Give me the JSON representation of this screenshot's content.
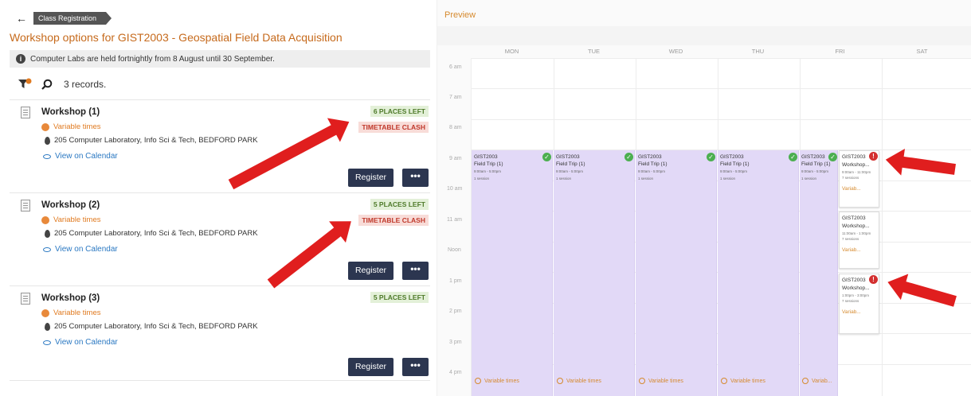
{
  "breadcrumb": {
    "back_icon": "arrow-left-icon",
    "label": "Class Registration"
  },
  "page_title": "Workshop options for GIST2003 - Geospatial Field Data Acquisition",
  "info_banner": "Computer Labs are held fortnightly from 8 August until 30 September.",
  "records_text": "3 records.",
  "workshops": [
    {
      "title": "Workshop (1)",
      "places": "6 PLACES LEFT",
      "clash": "TIMETABLE CLASH",
      "times": "Variable times",
      "location": "205 Computer Laboratory, Info Sci & Tech, BEDFORD PARK",
      "calendar_link": "View on Calendar",
      "register": "Register",
      "more": "•••"
    },
    {
      "title": "Workshop (2)",
      "places": "5 PLACES LEFT",
      "clash": "TIMETABLE CLASH",
      "times": "Variable times",
      "location": "205 Computer Laboratory, Info Sci & Tech, BEDFORD PARK",
      "calendar_link": "View on Calendar",
      "register": "Register",
      "more": "•••"
    },
    {
      "title": "Workshop (3)",
      "places": "5 PLACES LEFT",
      "clash": "",
      "times": "Variable times",
      "location": "205 Computer Laboratory, Info Sci & Tech, BEDFORD PARK",
      "calendar_link": "View on Calendar",
      "register": "Register",
      "more": "•••"
    }
  ],
  "preview": {
    "label": "Preview",
    "days": [
      "MON",
      "TUE",
      "WED",
      "THU",
      "FRI",
      "SAT"
    ],
    "times": [
      "6 am",
      "7 am",
      "8 am",
      "9 am",
      "10 am",
      "11 am",
      "Noon",
      "1 pm",
      "2 pm",
      "3 pm",
      "4 pm"
    ],
    "field_trips": [
      {
        "code": "GIST2003",
        "name": "Field Trip (1)",
        "time": "9:00am - 5:00pm",
        "sessions": "1 session",
        "footer": "Variable times"
      },
      {
        "code": "GIST2003",
        "name": "Field Trip (1)",
        "time": "9:00am - 5:00pm",
        "sessions": "1 session",
        "footer": "Variable times"
      },
      {
        "code": "GIST2003",
        "name": "Field Trip (1)",
        "time": "9:00am - 5:00pm",
        "sessions": "1 session",
        "footer": "Variable times"
      },
      {
        "code": "GIST2003",
        "name": "Field Trip (1)",
        "time": "9:00am - 5:00pm",
        "sessions": "1 session",
        "footer": "Variable times"
      },
      {
        "code": "GIST2003",
        "name": "Field Trip (1)",
        "time": "9:00am - 5:00pm",
        "sessions": "1 session",
        "footer": "Variab..."
      }
    ],
    "workshop_cards": [
      {
        "code": "GIST2003",
        "name": "Workshop...",
        "time": "9:00am - 11:00pm",
        "sessions": "7 sessions",
        "footer": "Variab..."
      },
      {
        "code": "GIST2003",
        "name": "Workshop...",
        "time": "11:00am - 1:00pm",
        "sessions": "7 sessions",
        "footer": "Variab..."
      },
      {
        "code": "GIST2003",
        "name": "Workshop...",
        "time": "1:00pm - 3:00pm",
        "sessions": "7 sessions",
        "footer": "Variab..."
      }
    ]
  },
  "colors": {
    "accent": "#c66a1c",
    "button": "#2c3650",
    "event_bg": "#e2d9f7",
    "arrow": "#e01e1e"
  }
}
